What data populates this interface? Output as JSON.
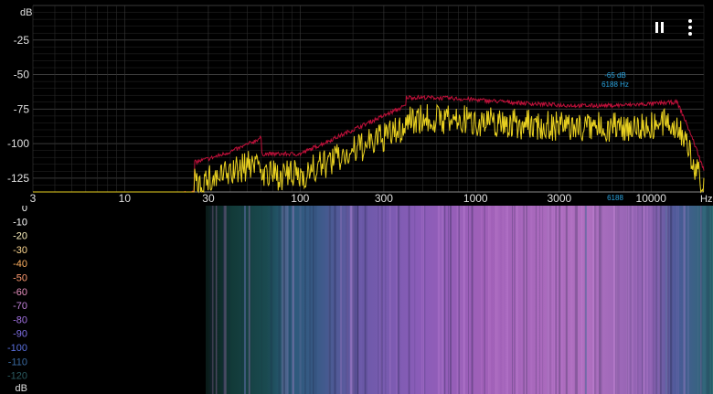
{
  "spectrum": {
    "y_axis_unit": "dB",
    "y_ticks": [
      "-25",
      "-50",
      "-75",
      "-100",
      "-125"
    ],
    "x_ticks": [
      "3",
      "10",
      "30",
      "100",
      "300",
      "1000",
      "3000",
      "10000"
    ],
    "x_unit": "Hz",
    "peak_marker": {
      "db_label": "-65 dB",
      "hz_label": "6188 Hz",
      "axis_label": "6188"
    },
    "colors": {
      "peak_trace": "#c0103a",
      "live_trace": "#e8d020",
      "peak_label": "#2aa4e0",
      "grid": "#2a2a2a"
    }
  },
  "controls": {
    "pause_icon": "pause-icon",
    "menu_icon": "more-vert-icon"
  },
  "spectrogram": {
    "scale_labels": [
      "0",
      "-10",
      "-20",
      "-30",
      "-40",
      "-50",
      "-60",
      "-70",
      "-80",
      "-90",
      "-100",
      "-110",
      "-120"
    ],
    "scale_unit": "dB",
    "scale_colors": [
      "#ffffff",
      "#ffffff",
      "#fff4c0",
      "#ffd890",
      "#ffb060",
      "#ff9a70",
      "#e890c0",
      "#c080d8",
      "#a070e0",
      "#8070e8",
      "#5a70e0",
      "#3a6aa0",
      "#2a5a60"
    ]
  }
}
